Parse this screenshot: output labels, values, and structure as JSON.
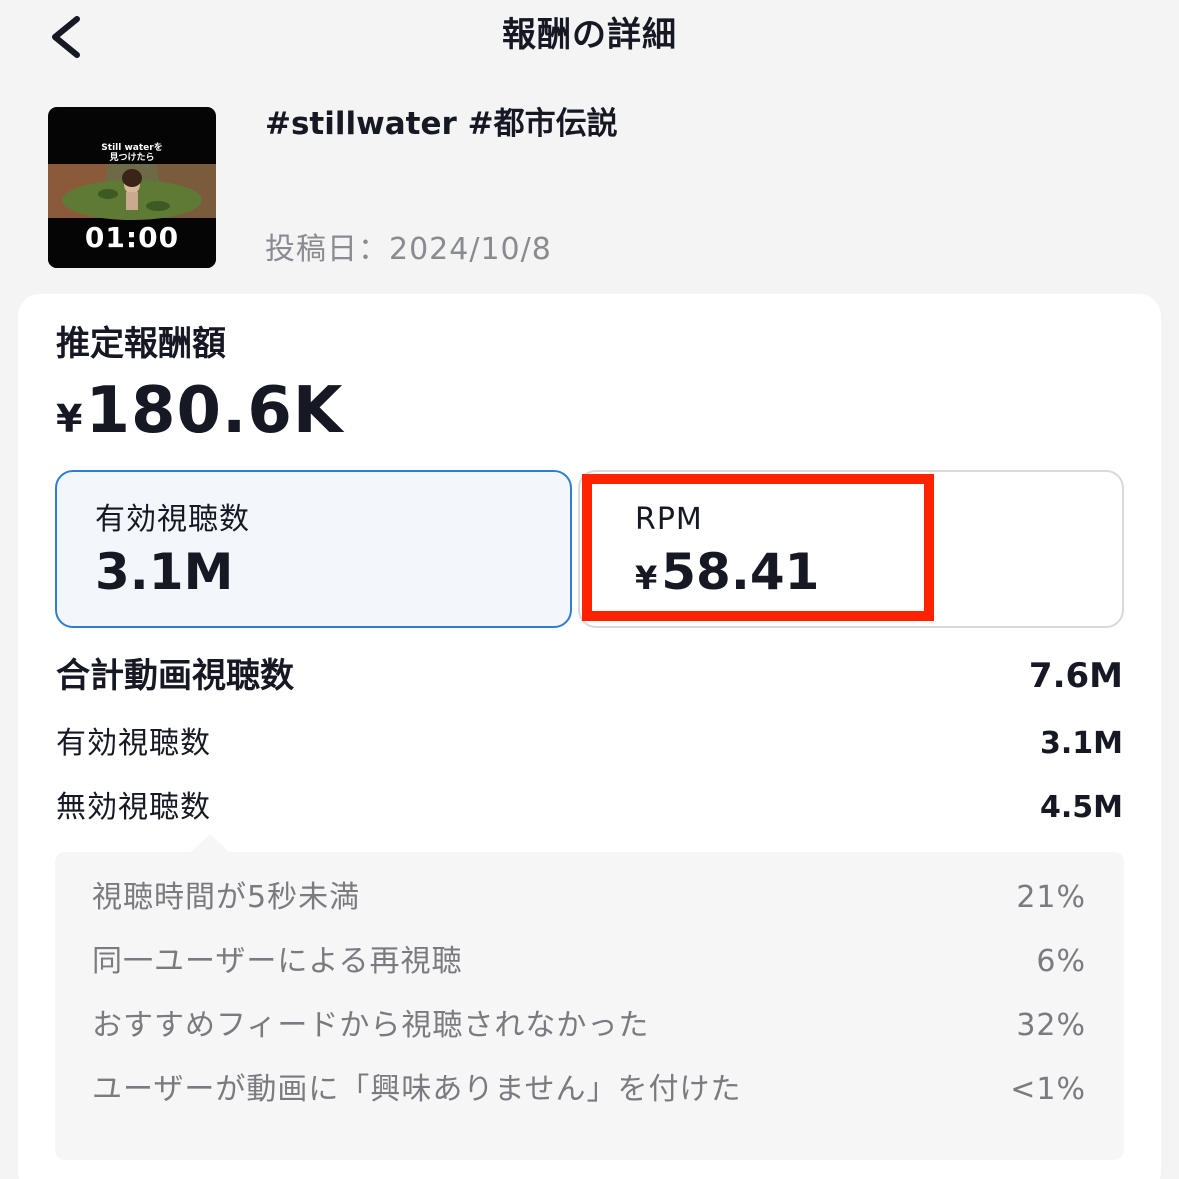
{
  "header": {
    "title": "報酬の詳細",
    "back_icon": "chevron-left-icon"
  },
  "video": {
    "thumbnail_caption": "Still waterを\n見つけたら",
    "duration": "01:00",
    "title": "#stillwater #都市伝説",
    "post_date": "投稿日：2024/10/8"
  },
  "earnings": {
    "label": "推定報酬額",
    "currency": "¥",
    "amount": "180.6K"
  },
  "metrics": {
    "valid_views_label": "有効視聴数",
    "valid_views_value": "3.1M",
    "rpm_label": "RPM",
    "rpm_currency": "¥",
    "rpm_value": "58.41"
  },
  "stats": {
    "total_label": "合計動画視聴数",
    "total_value": "7.6M",
    "valid_label": "有効視聴数",
    "valid_value": "3.1M",
    "invalid_label": "無効視聴数",
    "invalid_value": "4.5M"
  },
  "breakdown": [
    {
      "label": "視聴時間が5秒未満",
      "value": "21%"
    },
    {
      "label": "同一ユーザーによる再視聴",
      "value": "6%"
    },
    {
      "label": "おすすめフィードから視聴されなかった",
      "value": "32%"
    },
    {
      "label": "ユーザーが動画に「興味ありません」を付けた",
      "value": "<1%"
    }
  ],
  "colors": {
    "selected_border": "#2e7ed0",
    "highlight": "#ff2200",
    "muted_text": "#7a7b80"
  }
}
